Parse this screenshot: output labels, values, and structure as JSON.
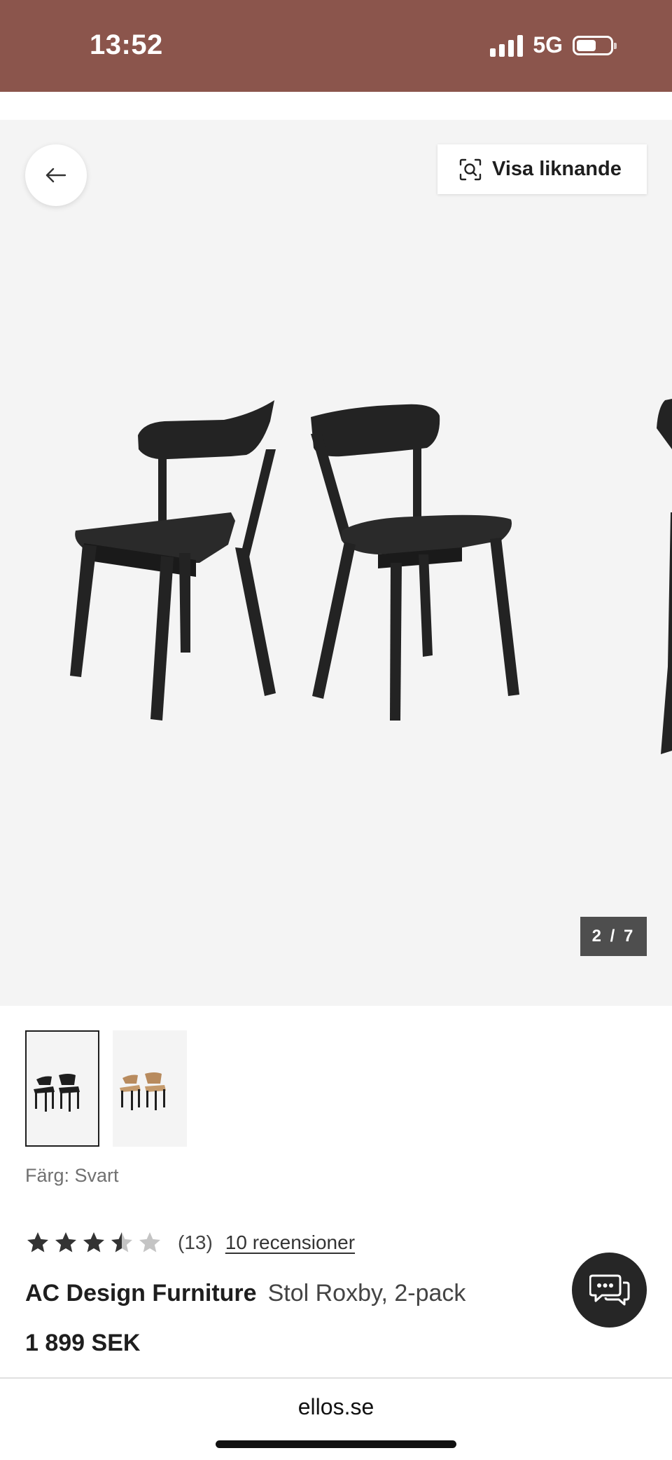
{
  "status_bar": {
    "time": "13:52",
    "network": "5G",
    "background": "#8b554c"
  },
  "gallery": {
    "back_icon": "arrow-left-icon",
    "similar_button": {
      "icon": "visual-search-icon",
      "label": "Visa liknande"
    },
    "counter": "2 / 7"
  },
  "thumbnails": [
    {
      "name": "black chairs",
      "selected": true
    },
    {
      "name": "oak chairs",
      "selected": false
    }
  ],
  "product": {
    "color_label": "Färg: Svart",
    "rating_value": 3.5,
    "rating_max": 5,
    "rating_count": "(13)",
    "reviews_link": "10 recensioner",
    "brand": "AC Design Furniture",
    "name": "Stol Roxby, 2-pack",
    "price": "1 899 SEK"
  },
  "chat": {
    "icon": "chat-bubbles-icon"
  },
  "browser": {
    "url": "ellos.se"
  }
}
